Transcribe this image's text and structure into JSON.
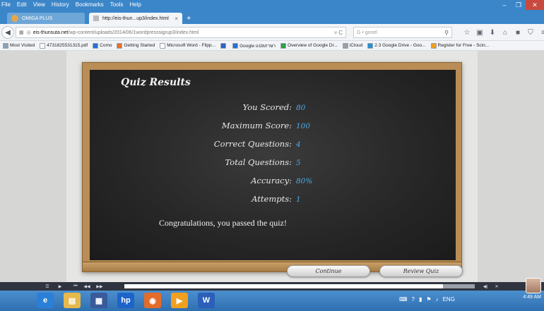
{
  "browser": {
    "menu": [
      "File",
      "Edit",
      "View",
      "History",
      "Bookmarks",
      "Tools",
      "Help"
    ],
    "tabs": [
      {
        "label": "OMIGA PLUS"
      },
      {
        "label": "http://eis-thun...up3/index.html",
        "close": "×"
      }
    ],
    "new_tab": "+",
    "url_host": "eis-thunsuta.net",
    "url_path": "/wp-content/uploads/2014/06/1wordpresssigrup3/index.html",
    "url_icons": "▿ C",
    "search_text": "G • gonel",
    "bookmarks": [
      {
        "label": "Most Visited",
        "color": "#8aa0b8"
      },
      {
        "label": "4731825531315.pdf",
        "color": "#ffffff"
      },
      {
        "label": "Como",
        "color": "#2a6fd6"
      },
      {
        "label": "Getting Started",
        "color": "#e8702a"
      },
      {
        "label": "Microsoft Word - Flipp...",
        "color": "#ffffff"
      },
      {
        "label": "",
        "color": "#2b61c9"
      },
      {
        "label": "Google แปลภาษา",
        "color": "#2a6fd6"
      },
      {
        "label": "Overview of Google Dr...",
        "color": "#2e9e4a"
      },
      {
        "label": "iCloud",
        "color": "#9aa0a8"
      },
      {
        "label": "2.3 Google Drive - Goo...",
        "color": "#2a8fd6"
      },
      {
        "label": "Register for Free - Scin...",
        "color": "#f0a020"
      }
    ]
  },
  "quiz": {
    "title": "Quiz Results",
    "results": [
      {
        "label": "You Scored:",
        "value": "80"
      },
      {
        "label": "Maximum Score:",
        "value": "100"
      },
      {
        "label": "Correct Questions:",
        "value": "4"
      },
      {
        "label": "Total Questions:",
        "value": "5"
      },
      {
        "label": "Accuracy:",
        "value": "80%"
      },
      {
        "label": "Attempts:",
        "value": "1"
      }
    ],
    "message": "Congratulations, you passed the quiz!",
    "continue_label": "Continue",
    "review_label": "Review Quiz"
  },
  "player": {
    "progress_fraction": 0.91
  },
  "taskbar": {
    "apps": [
      {
        "icon": "internet-explorer-icon",
        "color": "#2b7fd6",
        "glyph": "e"
      },
      {
        "icon": "file-explorer-icon",
        "color": "#e7b84a",
        "glyph": "▤"
      },
      {
        "icon": "media-icon",
        "color": "#3a5a9a",
        "glyph": "▦"
      },
      {
        "icon": "hp-icon",
        "color": "#1d64c9",
        "glyph": "hp"
      },
      {
        "icon": "firefox-icon",
        "color": "#e46b2a",
        "glyph": "◉"
      },
      {
        "icon": "media-player-icon",
        "color": "#f0a020",
        "glyph": "▶"
      },
      {
        "icon": "word-icon",
        "color": "#2b5fb8",
        "glyph": "W"
      }
    ],
    "language": "ENG",
    "time": "4:49 AM"
  }
}
